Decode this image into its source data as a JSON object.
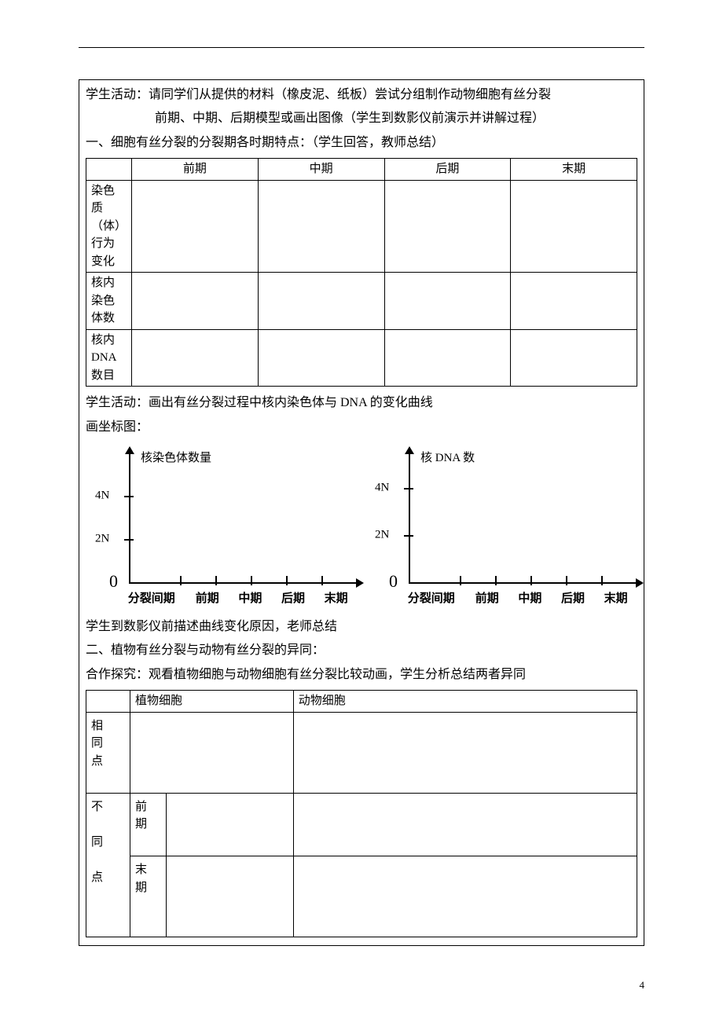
{
  "activity1": {
    "line1": "学生活动：请同学们从提供的材料（橡皮泥、纸板）尝试分组制作动物细胞有丝分裂",
    "line2": "前期、中期、后期模型或画出图像（学生到数影仪前演示并讲解过程）"
  },
  "section1_title": "一、细胞有丝分裂的分裂期各时期特点：（学生回答，教师总结）",
  "table1": {
    "headers": [
      "前期",
      "中期",
      "后期",
      "末期"
    ],
    "rows": [
      {
        "label_lines": [
          "染色",
          "质（体）",
          "行为",
          "变化"
        ]
      },
      {
        "label_lines": [
          "核内",
          "染色",
          "体数"
        ]
      },
      {
        "label_lines": [
          "核内",
          "DNA",
          "数目"
        ]
      }
    ]
  },
  "activity2": "学生活动：画出有丝分裂过程中核内染色体与 DNA 的变化曲线",
  "chart_intro": "画坐标图：",
  "chart_data": [
    {
      "type": "line",
      "title": "核染色体数量",
      "ylabel": "",
      "yticks": [
        "4N",
        "2N"
      ],
      "origin": "0",
      "categories": [
        "分裂间期",
        "前期",
        "中期",
        "后期",
        "末期"
      ]
    },
    {
      "type": "line",
      "title": "核 DNA 数",
      "ylabel": "",
      "yticks": [
        "4N",
        "2N"
      ],
      "origin": "0",
      "categories": [
        "分裂间期",
        "前期",
        "中期",
        "后期",
        "末期"
      ]
    }
  ],
  "post_chart": "学生到数影仪前描述曲线变化原因，老师总结",
  "section2_title": "二、植物有丝分裂与动物有丝分裂的异同：",
  "coop": "合作探究：观看植物细胞与动物细胞有丝分裂比较动画，学生分析总结两者异同",
  "table2": {
    "col_headers": [
      "植物细胞",
      "动物细胞"
    ],
    "row1_label_lines": [
      "相",
      "同",
      "点"
    ],
    "row2_label_lines": [
      "不",
      "",
      "同",
      "",
      "点"
    ],
    "sub1_lines": [
      "前",
      "期"
    ],
    "sub2_lines": [
      "末",
      "期"
    ]
  },
  "page_number": "4"
}
